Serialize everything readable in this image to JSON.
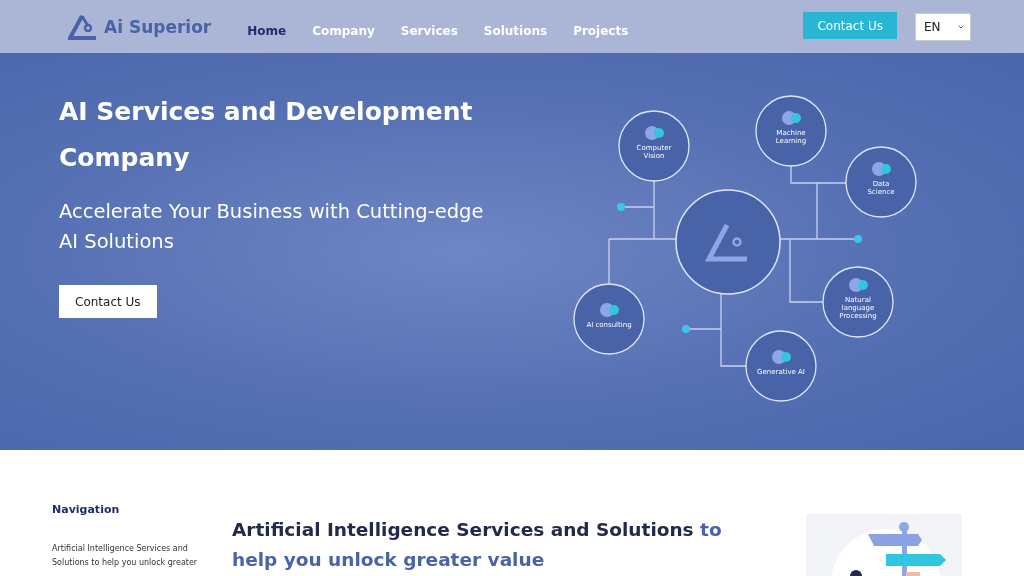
{
  "header": {
    "logo": "Ai Superior",
    "nav": [
      {
        "label": "Home",
        "selected": true
      },
      {
        "label": "Company",
        "selected": false
      },
      {
        "label": "Services",
        "selected": false
      },
      {
        "label": "Solutions",
        "selected": false
      },
      {
        "label": "Projects",
        "selected": false
      }
    ],
    "cta": "Contact Us",
    "language": "EN"
  },
  "hero": {
    "title": "AI Services and Development Company",
    "subtitle": "Accelerate Your Business with Cutting-edge AI Solutions",
    "button": "Contact Us",
    "diagram": [
      {
        "label": [
          "Computer",
          "Vision"
        ]
      },
      {
        "label": [
          "Machine",
          "Learning"
        ]
      },
      {
        "label": [
          "Data",
          "Science"
        ]
      },
      {
        "label": [
          "Natural",
          "language",
          "Processing"
        ]
      },
      {
        "label": [
          "Generative AI"
        ]
      },
      {
        "label": [
          "AI consulting"
        ]
      }
    ]
  },
  "content": {
    "nav_title": "Navigation",
    "nav_text": "Artificial Intelligence Services and Solutions to help you unlock greater",
    "heading_main": "Artificial Intelligence Services and Solutions",
    "heading_accent": "to help you unlock greater value"
  }
}
